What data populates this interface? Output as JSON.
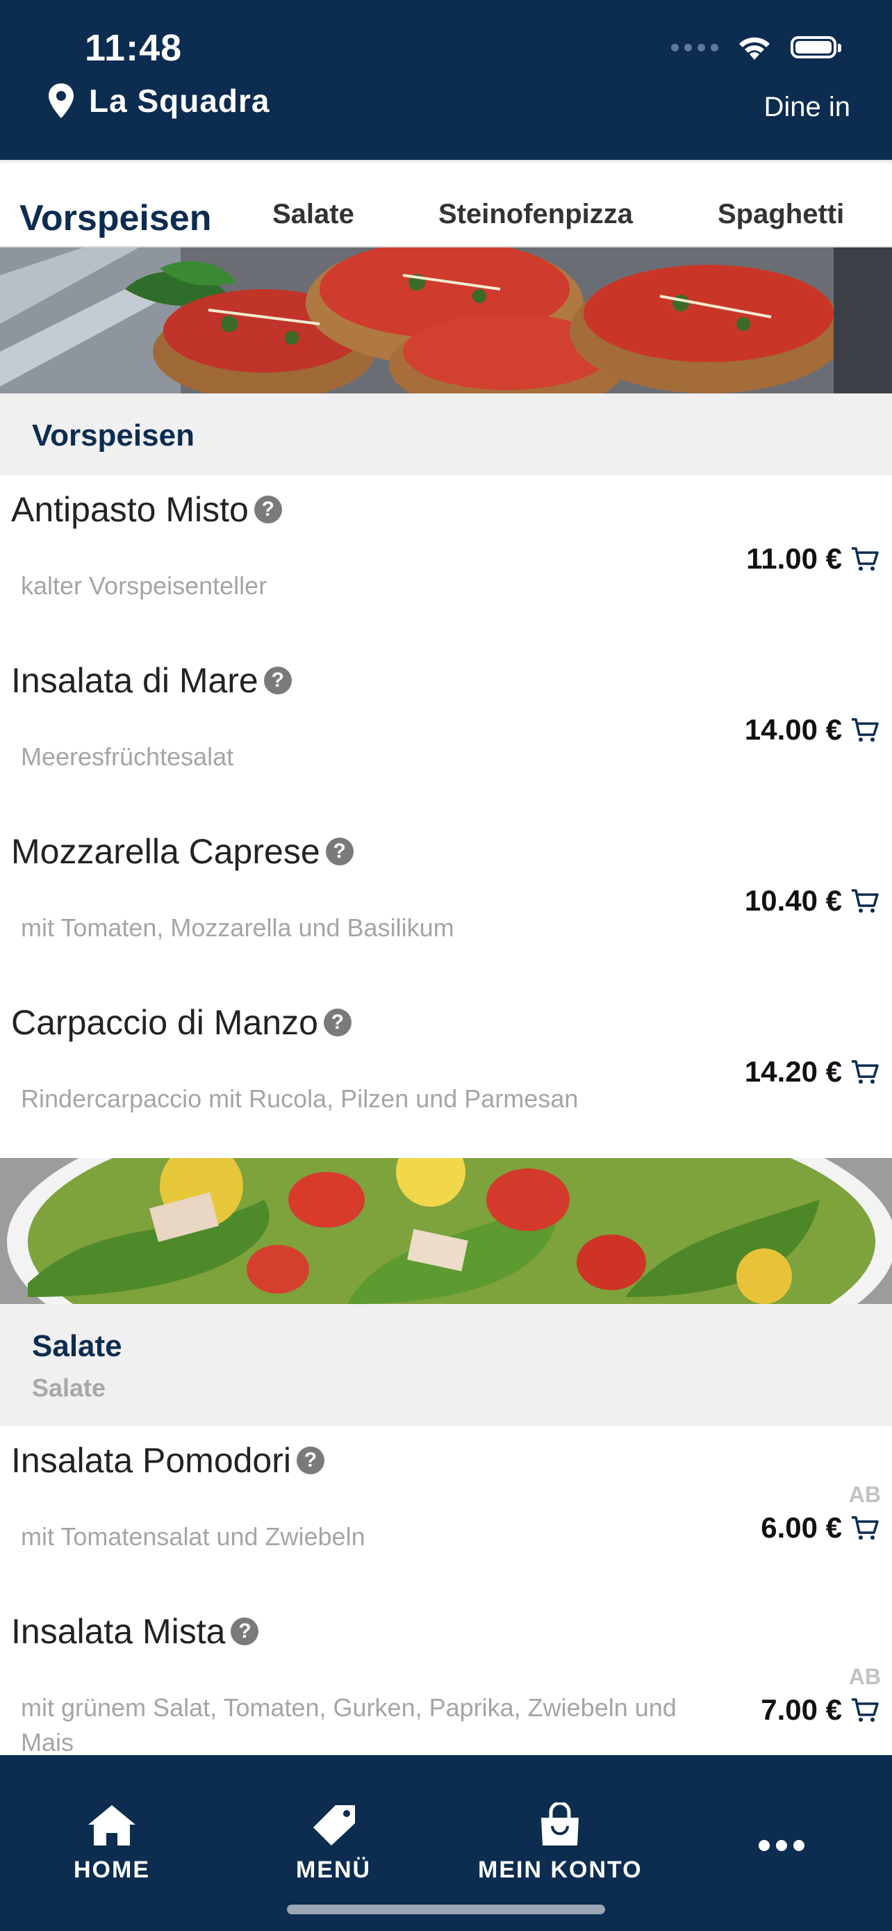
{
  "status_bar": {
    "time": "11:48"
  },
  "header": {
    "store_name": "La Squadra",
    "mode": "Dine in"
  },
  "tabs": [
    {
      "label": "Vorspeisen",
      "active": true
    },
    {
      "label": "Salate",
      "active": false
    },
    {
      "label": "Steinofenpizza",
      "active": false
    },
    {
      "label": "Spaghetti",
      "active": false
    }
  ],
  "sections": [
    {
      "title": "Vorspeisen",
      "items": [
        {
          "name": "Antipasto Misto",
          "description": "kalter Vorspeisenteller",
          "price": "11.00 €"
        },
        {
          "name": "Insalata di Mare",
          "description": "Meeresfrüchtesalat",
          "price": "14.00 €"
        },
        {
          "name": "Mozzarella Caprese",
          "description": "mit Tomaten, Mozzarella und Basilikum",
          "price": "10.40 €"
        },
        {
          "name": "Carpaccio di Manzo",
          "description": "Rindercarpaccio mit Rucola, Pilzen und Parmesan",
          "price": "14.20 €"
        }
      ]
    },
    {
      "title": "Salate",
      "subtitle": "Salate",
      "items": [
        {
          "name": "Insalata Pomodori",
          "description": "mit Tomatensalat und Zwiebeln",
          "price": "6.00 €",
          "prefix": "AB"
        },
        {
          "name": "Insalata Mista",
          "description": "mit grünem Salat, Tomaten, Gurken, Paprika, Zwiebeln und Mais",
          "price": "7.00 €",
          "prefix": "AB"
        }
      ]
    }
  ],
  "bottom_nav": [
    {
      "label": "HOME",
      "icon": "home-icon"
    },
    {
      "label": "MENÜ",
      "icon": "tag-icon"
    },
    {
      "label": "MEIN KONTO",
      "icon": "shopping-bag-icon"
    },
    {
      "label": "",
      "icon": "more-icon"
    }
  ],
  "colors": {
    "primary": "#0c2c50",
    "section_bg": "#f0f0f0",
    "muted_text": "#a5a5a5"
  }
}
